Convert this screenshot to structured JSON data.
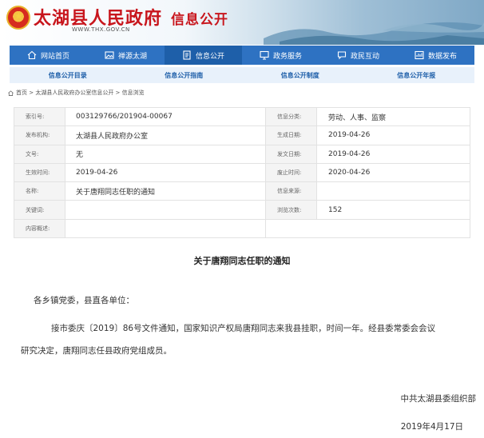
{
  "header": {
    "site_title": "太湖县人民政府",
    "site_url": "WWW.THX.GOV.CN",
    "channel_title": "信息公开"
  },
  "nav": {
    "items": [
      {
        "label": "网站首页",
        "icon": "home-icon"
      },
      {
        "label": "禅源太湖",
        "icon": "image-icon"
      },
      {
        "label": "信息公开",
        "icon": "document-icon",
        "active": true
      },
      {
        "label": "政务服务",
        "icon": "monitor-icon"
      },
      {
        "label": "政民互动",
        "icon": "chat-icon"
      },
      {
        "label": "数据发布",
        "icon": "data-icon"
      }
    ]
  },
  "subnav": {
    "items": [
      "信息公开目录",
      "信息公开指南",
      "信息公开制度",
      "信息公开年报"
    ]
  },
  "breadcrumb": {
    "text": "首页 > 太湖县人民政府办公室信息公开 > 信息浏览"
  },
  "meta": {
    "rows": [
      {
        "k1": "索引号:",
        "v1": "003129766/201904-00067",
        "k2": "信息分类:",
        "v2": "劳动、人事、监察"
      },
      {
        "k1": "发布机构:",
        "v1": "太湖县人民政府办公室",
        "k2": "生成日期:",
        "v2": "2019-04-26"
      },
      {
        "k1": "文号:",
        "v1": "无",
        "k2": "发文日期:",
        "v2": "2019-04-26"
      },
      {
        "k1": "生效时间:",
        "v1": "2019-04-26",
        "k2": "废止时间:",
        "v2": "2020-04-26"
      },
      {
        "k1": "名称:",
        "v1": "关于唐翔同志任职的通知",
        "k2": "信息来源:",
        "v2": ""
      },
      {
        "k1": "关键词:",
        "v1": "",
        "k2": "浏览次数:",
        "v2": "152"
      },
      {
        "k1": "内容概述:",
        "v1": "",
        "k2": "",
        "v2": ""
      }
    ]
  },
  "article": {
    "title": "关于唐翔同志任职的通知",
    "salutation": "各乡镇党委，县直各单位：",
    "body_line1": "接市委庆〔2019〕86号文件通知，国家知识产权局唐翔同志来我县挂职，时间一年。经县委常委会会议",
    "body_line2": "研究决定，唐翔同志任县政府党组成员。",
    "sign_org": "中共太湖县委组织部",
    "sign_date": "2019年4月17日"
  },
  "colors": {
    "nav": "#2e72c2",
    "brand_red": "#c8161d",
    "subnav_bg": "#e8f1fb"
  }
}
